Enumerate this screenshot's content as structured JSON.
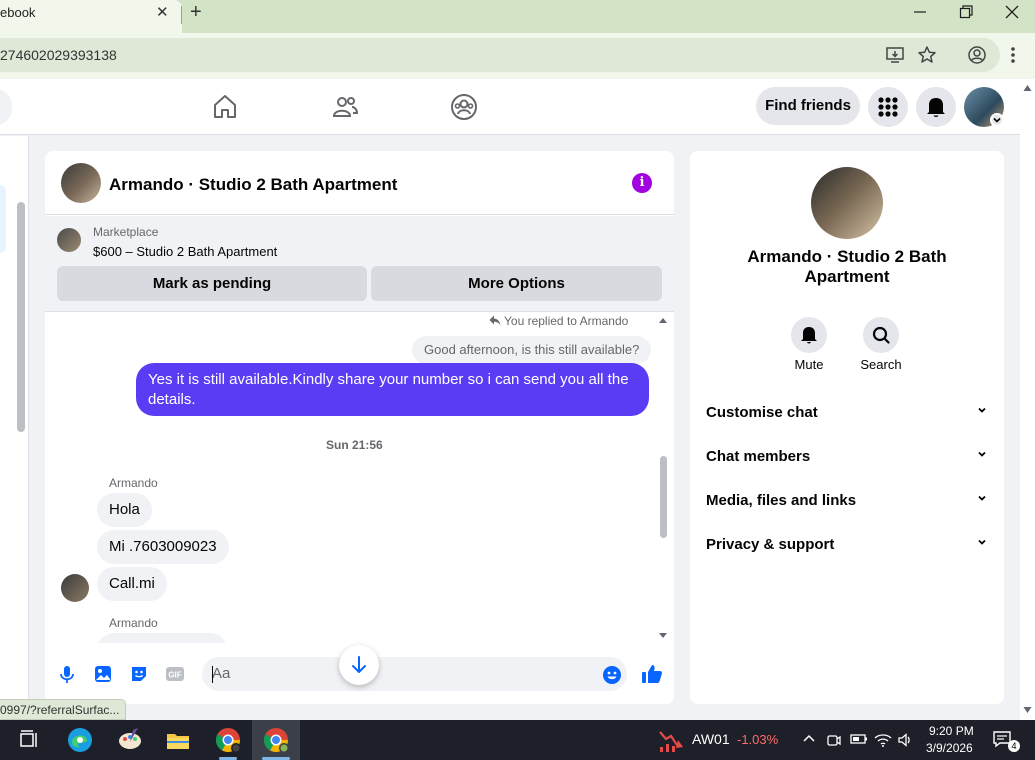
{
  "browser": {
    "tab_title": "ebook",
    "tab_close": "✕",
    "new_tab": "+",
    "url": "274602029393138",
    "status_url": "0997/?referralSurfac..."
  },
  "fb_nav": {
    "find_friends": "Find friends"
  },
  "chat": {
    "title": "Armando · Studio 2 Bath Apartment",
    "marketplace_label": "Marketplace",
    "listing": "$600 – Studio 2 Bath Apartment",
    "mark_pending": "Mark as pending",
    "more_options": "More Options",
    "replied_note": "You replied to Armando",
    "quoted_message": "Good afternoon, is this still available?",
    "outgoing_message": "Yes it is still available.Kindly share your number so i can send you all the details.",
    "timestamp": "Sun 21:56",
    "sender_name": "Armando",
    "incoming": [
      {
        "text": "Hola"
      },
      {
        "text": "Mi .7603009023"
      },
      {
        "text": "Call.mi"
      }
    ],
    "sender_name_2": "Armando",
    "composer_placeholder": "Aa"
  },
  "info_panel": {
    "name": "Armando · Studio 2 Bath Apartment",
    "mute_label": "Mute",
    "search_label": "Search",
    "sections": [
      {
        "label": "Customise chat"
      },
      {
        "label": "Chat members"
      },
      {
        "label": "Media, files and links"
      },
      {
        "label": "Privacy & support"
      }
    ]
  },
  "taskbar": {
    "stock_name": "AW01",
    "stock_change": "-1.03%",
    "time": "9:20 PM",
    "date": "3/9/2026",
    "notification_count": "4"
  },
  "colors": {
    "accent_purple": "#5b3cf5",
    "info_icon": "#a300e0",
    "like_blue": "#0866ff"
  }
}
